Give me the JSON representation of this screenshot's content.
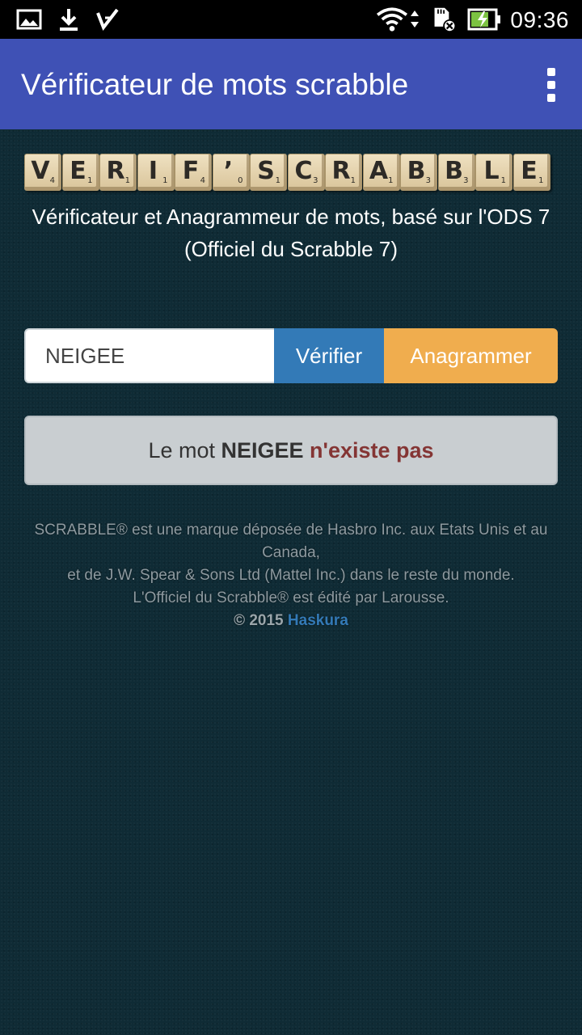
{
  "status_bar": {
    "time": "09:36",
    "icons": [
      "image-icon",
      "download-icon",
      "checkmark-app-icon",
      "wifi-icon",
      "sd-card-icon",
      "battery-charging-icon"
    ]
  },
  "app_bar": {
    "title": "Vérificateur de mots scrabble",
    "menu_icon": "more-vert-icon",
    "color": "#3f51b5"
  },
  "logo": {
    "tiles": [
      {
        "letter": "V",
        "points": "4"
      },
      {
        "letter": "E",
        "points": "1"
      },
      {
        "letter": "R",
        "points": "1"
      },
      {
        "letter": "I",
        "points": "1"
      },
      {
        "letter": "F",
        "points": "4"
      },
      {
        "letter": "’",
        "points": "0"
      },
      {
        "letter": "S",
        "points": "1"
      },
      {
        "letter": "C",
        "points": "3"
      },
      {
        "letter": "R",
        "points": "1"
      },
      {
        "letter": "A",
        "points": "1"
      },
      {
        "letter": "B",
        "points": "3"
      },
      {
        "letter": "B",
        "points": "3"
      },
      {
        "letter": "L",
        "points": "1"
      },
      {
        "letter": "E",
        "points": "1"
      }
    ]
  },
  "subtitle": "Vérificateur et Anagrammeur de mots, basé sur l'ODS 7 (Officiel du Scrabble 7)",
  "search": {
    "value": "NEIGEE",
    "verify_label": "Vérifier",
    "anagram_label": "Anagrammer",
    "verify_color": "#337ab7",
    "anagram_color": "#f0ad4e"
  },
  "result": {
    "prefix": "Le mot",
    "word": "NEIGEE",
    "verdict": "n'existe pas"
  },
  "footer": {
    "line1": "SCRABBLE® est une marque déposée de Hasbro Inc. aux Etats Unis et au Canada,",
    "line2": "et de J.W. Spear & Sons Ltd (Mattel Inc.) dans le reste du monde.",
    "line3": "L'Officiel du Scrabble® est édité par Larousse.",
    "copyright": "© 2015",
    "author": "Haskura"
  }
}
